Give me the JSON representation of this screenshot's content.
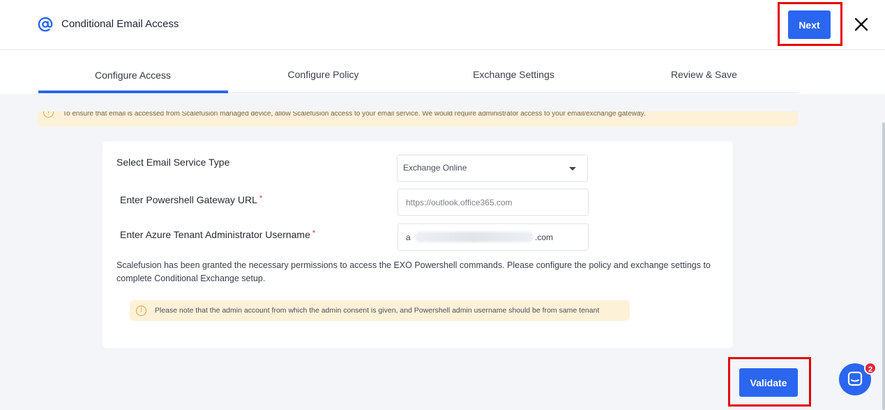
{
  "header": {
    "icon": "at-sign-icon",
    "title": "Conditional Email Access",
    "next_label": "Next"
  },
  "tabs": [
    {
      "label": "Configure Access",
      "active": true
    },
    {
      "label": "Configure Policy",
      "active": false
    },
    {
      "label": "Exchange Settings",
      "active": false
    },
    {
      "label": "Review & Save",
      "active": false
    }
  ],
  "banner": {
    "text": "To ensure that email is accessed from Scalefusion managed device, allow Scalefusion access to your email service. We would require administrator access to your email/exchange gateway."
  },
  "form": {
    "service_type_label": "Select Email Service Type",
    "service_type_value": "Exchange Online",
    "gateway_label": "Enter Powershell Gateway URL",
    "gateway_placeholder": "https://outlook.office365.com",
    "username_label": "Enter Azure Tenant Administrator Username",
    "username_prefix": "a",
    "username_suffix": ".com",
    "required_mark": "*",
    "permission_text": "Scalefusion has been granted the necessary permissions to access the EXO Powershell commands. Please configure the policy and exchange settings to complete Conditional Exchange setup.",
    "note_text": "Please note that the admin account from which the admin consent is given, and Powershell admin username should be from same tenant"
  },
  "actions": {
    "validate_label": "Validate"
  },
  "chat": {
    "badge_count": "2"
  },
  "colors": {
    "accent": "#2a66f0",
    "highlight": "#e60000",
    "warning_bg": "#fdf1d8"
  }
}
